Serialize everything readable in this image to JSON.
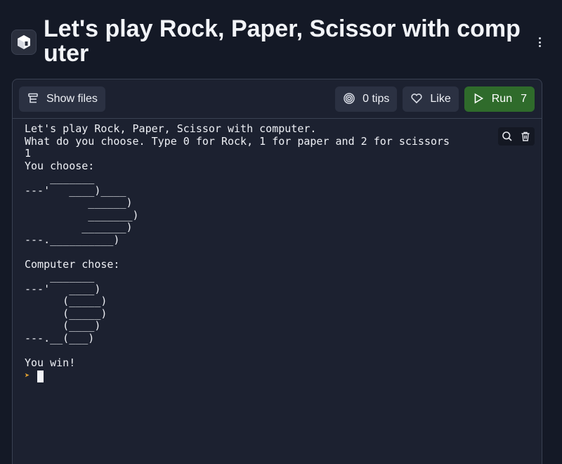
{
  "header": {
    "title": "Let's play Rock, Paper, Scissor with computer",
    "logo_icon": "bun-logo-icon",
    "menu_icon": "kebab-menu-icon"
  },
  "toolbar": {
    "show_files_label": "Show files",
    "tips_label": "0 tips",
    "like_label": "Like",
    "run_label": "Run",
    "run_count": "7"
  },
  "console": {
    "output": "Let's play Rock, Paper, Scissor with computer.\nWhat do you choose. Type 0 for Rock, 1 for paper and 2 for scissors\n1\nYou choose:\n    _______\n---'   ____)____\n          ______)\n          _______)\n         _______)\n---.__________)\n\nComputer chose:\n    _______\n---'   ____)\n      (_____)\n      (_____)\n      (____)\n---.__(___)\n\nYou win!",
    "search_icon": "search-icon",
    "clear_icon": "trash-icon"
  },
  "colors": {
    "background": "#141926",
    "panel": "#1c2130",
    "button": "#2b3142",
    "run_button": "#2f6b2b",
    "prompt_arrow": "#e0a030"
  }
}
